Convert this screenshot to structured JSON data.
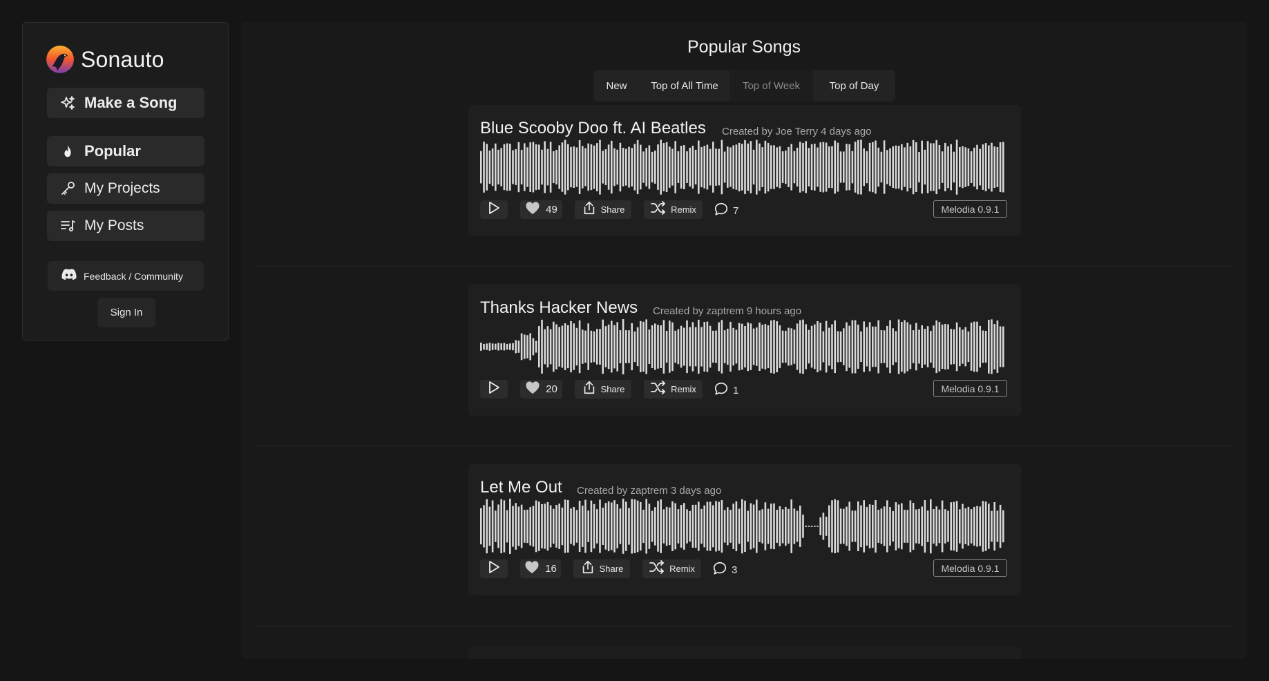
{
  "brand": {
    "name": "Sonauto"
  },
  "sidebar": {
    "make_song": "Make a Song",
    "items": [
      {
        "label": "Popular",
        "icon": "flame-icon"
      },
      {
        "label": "My Projects",
        "icon": "key-icon"
      },
      {
        "label": "My Posts",
        "icon": "playlist-icon"
      }
    ],
    "feedback": "Feedback / Community",
    "sign_in": "Sign In"
  },
  "main": {
    "title": "Popular Songs",
    "tabs": [
      {
        "label": "New"
      },
      {
        "label": "Top of All Time"
      },
      {
        "label": "Top of Week"
      },
      {
        "label": "Top of Day"
      }
    ]
  },
  "songs": [
    {
      "title": "Blue Scooby Doo ft. AI Beatles",
      "meta": "Created by Joe Terry 4 days ago",
      "likes": "49",
      "share": "Share",
      "remix": "Remix",
      "comments": "7",
      "model": "Melodia 0.9.1"
    },
    {
      "title": "Thanks Hacker News",
      "meta": "Created by zaptrem 9 hours ago",
      "likes": "20",
      "share": "Share",
      "remix": "Remix",
      "comments": "1",
      "model": "Melodia 0.9.1"
    },
    {
      "title": "Let Me Out",
      "meta": "Created by zaptrem 3 days ago",
      "likes": "16",
      "share": "Share",
      "remix": "Remix",
      "comments": "3",
      "model": "Melodia 0.9.1"
    }
  ],
  "colors": {
    "background": "#151515",
    "panel": "#191919",
    "card": "#1f1f1f",
    "waveform": "#d9d9d9",
    "button": "#2c2c2c"
  }
}
